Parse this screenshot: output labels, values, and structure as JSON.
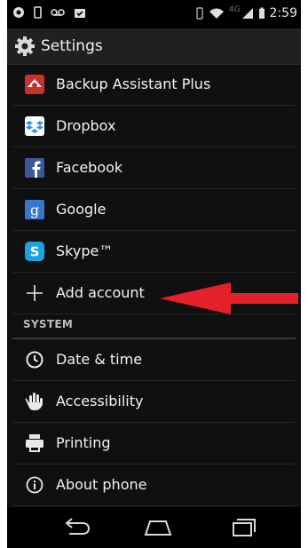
{
  "status": {
    "time": "2:59",
    "network": "4G"
  },
  "actionbar": {
    "title": "Settings"
  },
  "accounts": [
    {
      "label": "Backup Assistant Plus",
      "icon": "backup-assistant-icon"
    },
    {
      "label": "Dropbox",
      "icon": "dropbox-icon"
    },
    {
      "label": "Facebook",
      "icon": "facebook-icon"
    },
    {
      "label": "Google",
      "icon": "google-icon"
    },
    {
      "label": "Skype™",
      "icon": "skype-icon"
    },
    {
      "label": "Add account",
      "icon": "plus-icon"
    }
  ],
  "system": {
    "header": "SYSTEM",
    "items": [
      {
        "label": "Date & time",
        "icon": "clock-icon"
      },
      {
        "label": "Accessibility",
        "icon": "hand-icon"
      },
      {
        "label": "Printing",
        "icon": "printer-icon"
      },
      {
        "label": "About phone",
        "icon": "info-icon"
      }
    ]
  },
  "colors": {
    "background": "#101010",
    "arrow": "#e5202a",
    "dropbox": "#3d8fe0",
    "facebook": "#3b5998",
    "google": "#3a76c9",
    "skype": "#1aa3e0",
    "backup": "#c9312a"
  }
}
